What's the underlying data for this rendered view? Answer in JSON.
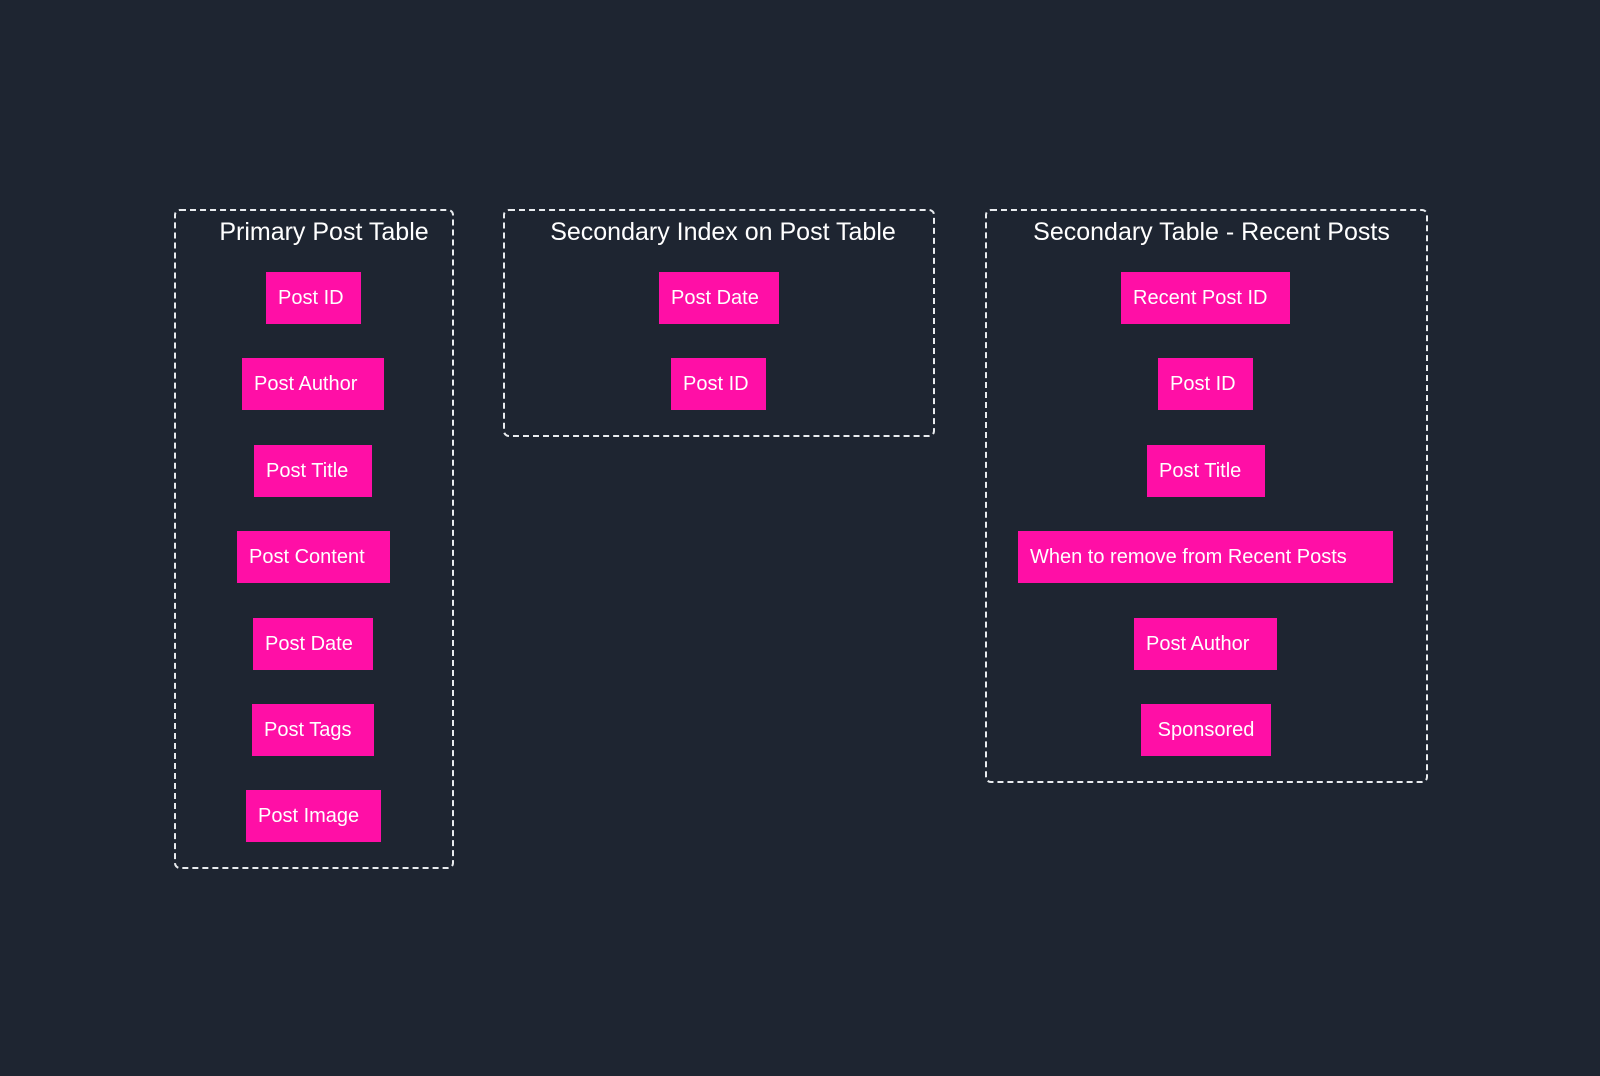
{
  "diagram": {
    "groups": [
      {
        "title": "Primary Post Table",
        "fields": [
          "Post ID",
          "Post Author",
          "Post Title",
          "Post Content",
          "Post Date",
          "Post Tags",
          "Post Image"
        ]
      },
      {
        "title": "Secondary Index on Post Table",
        "fields": [
          "Post Date",
          "Post ID"
        ]
      },
      {
        "title": "Secondary Table - Recent Posts",
        "fields": [
          "Recent Post ID",
          "Post ID",
          "Post Title",
          "When to remove from Recent Posts",
          "Post Author",
          "Sponsored"
        ]
      }
    ]
  },
  "colors": {
    "background": "#1e2531",
    "field_fill": "#ff0fa6",
    "text": "#ffffff",
    "group_border": "#e9ecef"
  }
}
